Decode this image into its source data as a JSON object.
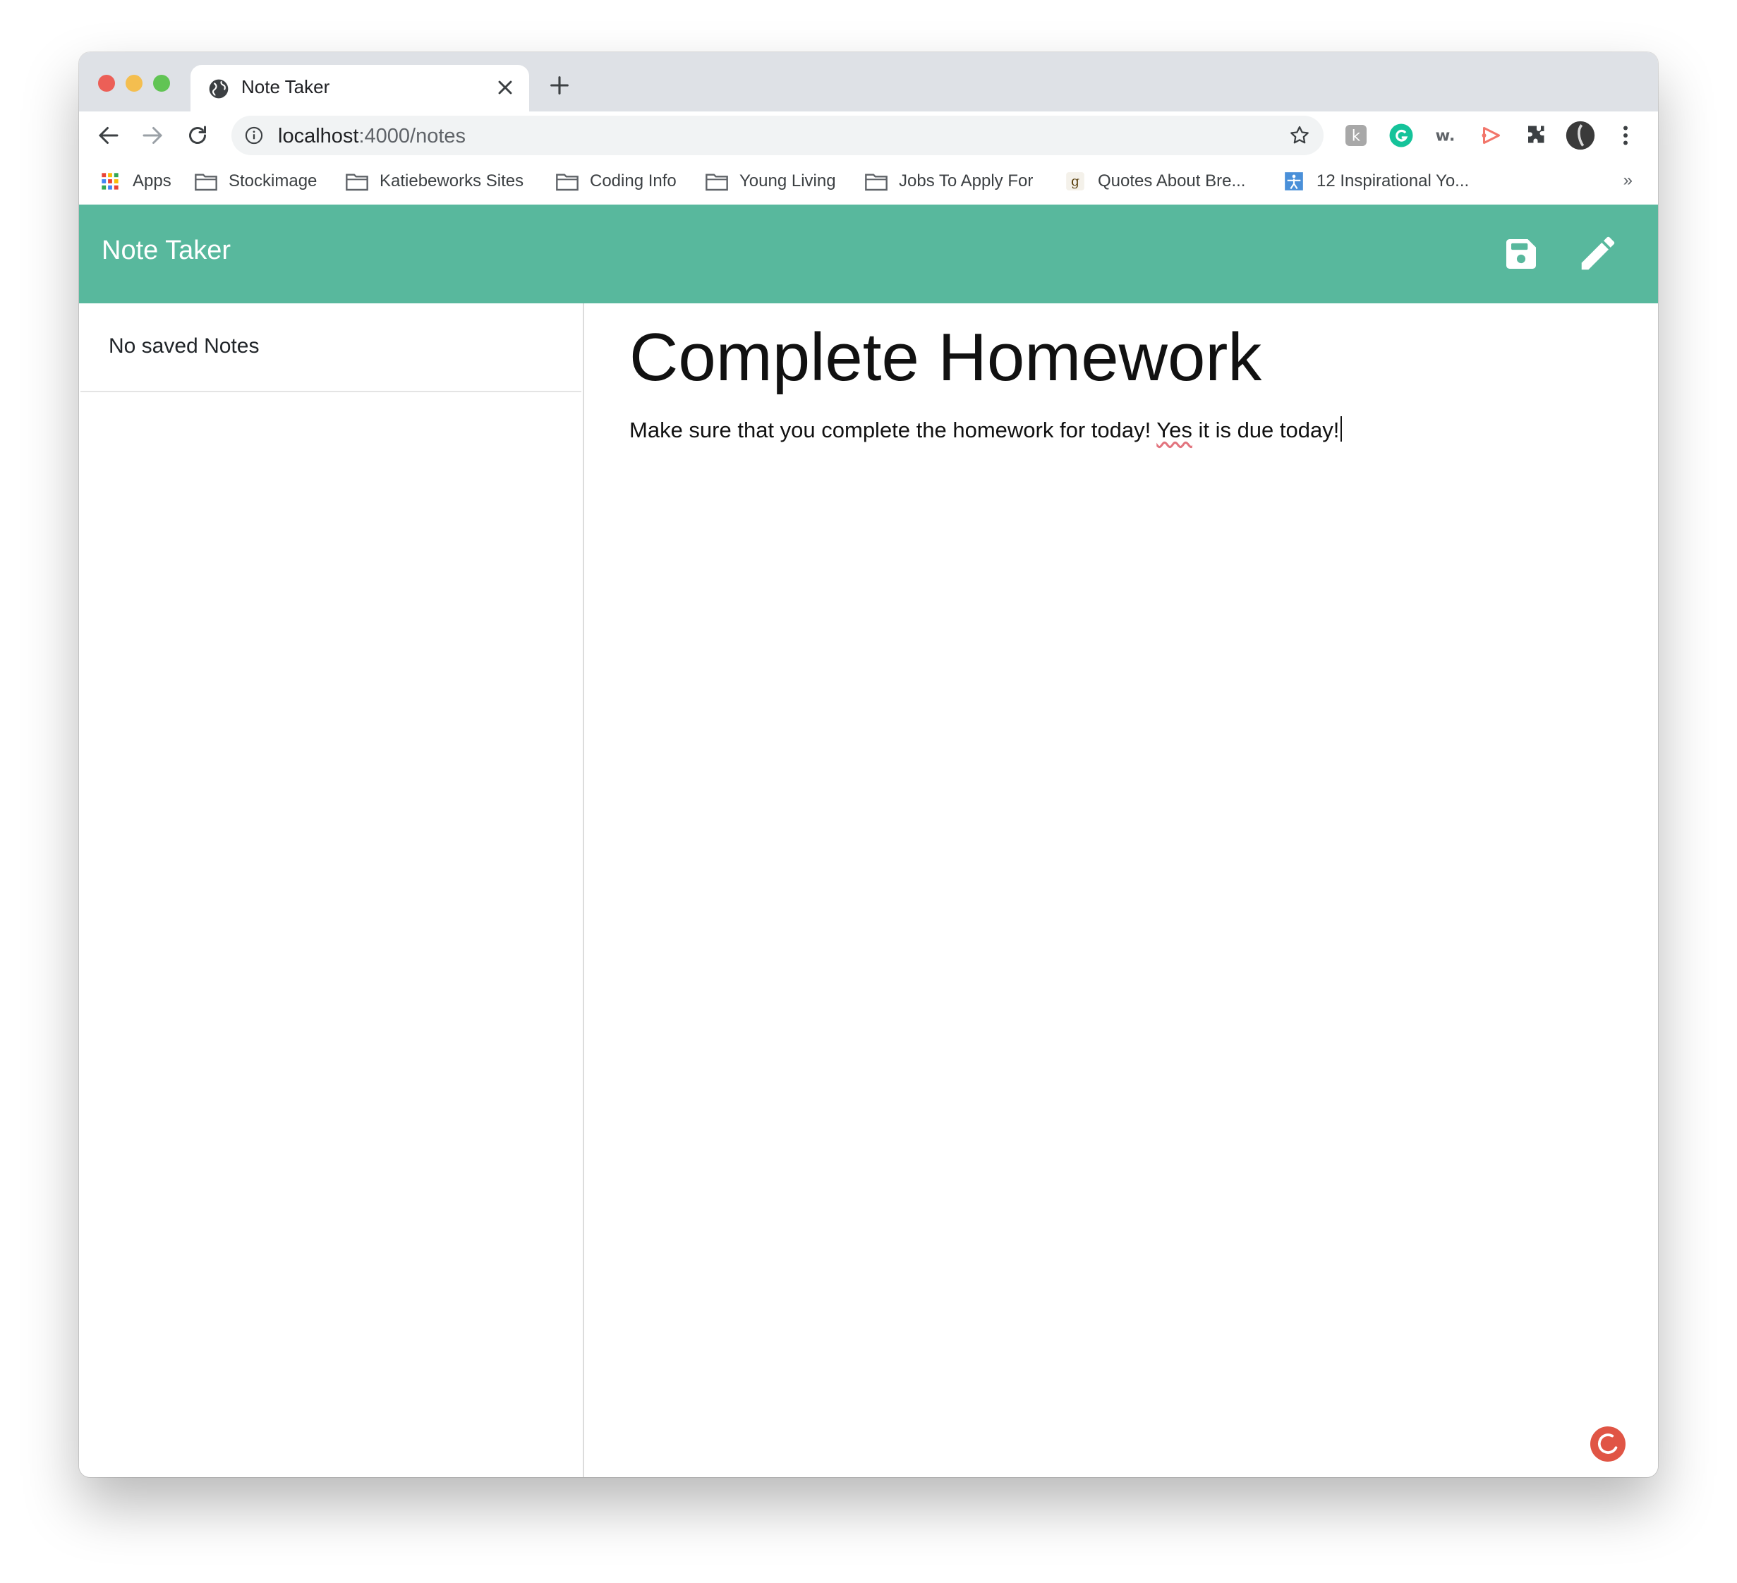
{
  "browser": {
    "tab_title": "Note Taker",
    "url_host": "localhost",
    "url_path": ":4000/notes",
    "bookmarks": [
      {
        "label": "Apps",
        "icon": "apps-grid-icon"
      },
      {
        "label": "Stockimage",
        "icon": "folder-icon"
      },
      {
        "label": "Katiebeworks Sites",
        "icon": "folder-icon"
      },
      {
        "label": "Coding Info",
        "icon": "folder-icon"
      },
      {
        "label": "Young Living",
        "icon": "folder-icon"
      },
      {
        "label": "Jobs To Apply For",
        "icon": "folder-icon"
      },
      {
        "label": "Quotes About Bre...",
        "icon": "goodreads-icon"
      },
      {
        "label": "12 Inspirational Yo...",
        "icon": "yoga-icon"
      }
    ],
    "more_bookmarks": "»"
  },
  "app": {
    "brand": "Note Taker",
    "sidebar": {
      "empty_text": "No saved Notes"
    },
    "note": {
      "title": "Complete Homework",
      "body_before": "Make sure that you complete the homework for today! ",
      "body_misspelled": "Yes",
      "body_after": " it is due today!"
    }
  },
  "colors": {
    "navbar": "#58b89d",
    "fab": "#e05545"
  }
}
